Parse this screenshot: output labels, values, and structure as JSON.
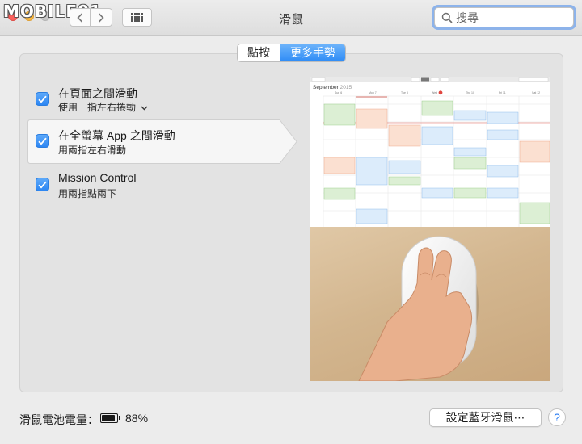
{
  "window": {
    "title": "滑鼠",
    "watermark": "MOBILE01"
  },
  "toolbar": {
    "back_icon": "chevron-left-icon",
    "forward_icon": "chevron-right-icon",
    "show_all_icon": "grid-icon",
    "search_placeholder": "搜尋"
  },
  "tabs": {
    "items": [
      {
        "label": "點按",
        "selected": false
      },
      {
        "label": "更多手勢",
        "selected": true
      }
    ]
  },
  "options": [
    {
      "title": "在頁面之間滑動",
      "subtitle": "使用一指左右捲動",
      "checked": true,
      "has_dropdown": true
    },
    {
      "title": "在全螢幕 App 之間滑動",
      "subtitle": "用兩指左右滑動",
      "checked": true,
      "selected": true
    },
    {
      "title": "Mission Control",
      "subtitle": "用兩指點兩下",
      "checked": true
    }
  ],
  "preview": {
    "calendar_month": "September",
    "calendar_year": "2015"
  },
  "footer": {
    "battery_label": "滑鼠電池電量：",
    "battery_percent": "88%",
    "battery_level": 0.88,
    "bluetooth_button": "設定藍牙滑鼠⋯",
    "help_button": "?"
  },
  "colors": {
    "accent": "#2f8cf6",
    "checkbox": "#3d92f5",
    "focus_ring": "#8db3ea"
  }
}
